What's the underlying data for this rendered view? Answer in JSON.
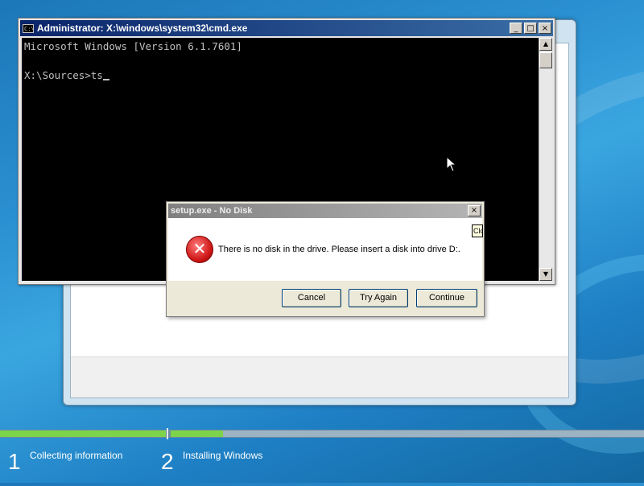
{
  "cmd_window": {
    "title": "Administrator: X:\\windows\\system32\\cmd.exe",
    "icon_text": "C:\\",
    "console_lines": [
      "Microsoft Windows [Version 6.1.7601]",
      "",
      "X:\\Sources>ts"
    ],
    "minimize_glyph": "_",
    "maximize_glyph": "□",
    "close_glyph": "×",
    "scroll_up_glyph": "▲",
    "scroll_down_glyph": "▼"
  },
  "dialog": {
    "title": "setup.exe - No Disk",
    "message": "There is no disk in the drive. Please insert a disk into drive D:.",
    "error_glyph": "✕",
    "close_glyph": "×",
    "buttons": {
      "cancel": "Cancel",
      "try_again": "Try Again",
      "continue": "Continue"
    }
  },
  "tooltip": {
    "text": "Clo"
  },
  "steps": [
    {
      "number": "1",
      "label": "Collecting information"
    },
    {
      "number": "2",
      "label": "Installing Windows"
    }
  ],
  "progress": {
    "step1_fraction": 1.0,
    "step2_fraction": 0.11
  },
  "colors": {
    "progress_fill": "#7dd34a",
    "cmd_title": "#0a246a",
    "error_red": "#d11a1a"
  }
}
